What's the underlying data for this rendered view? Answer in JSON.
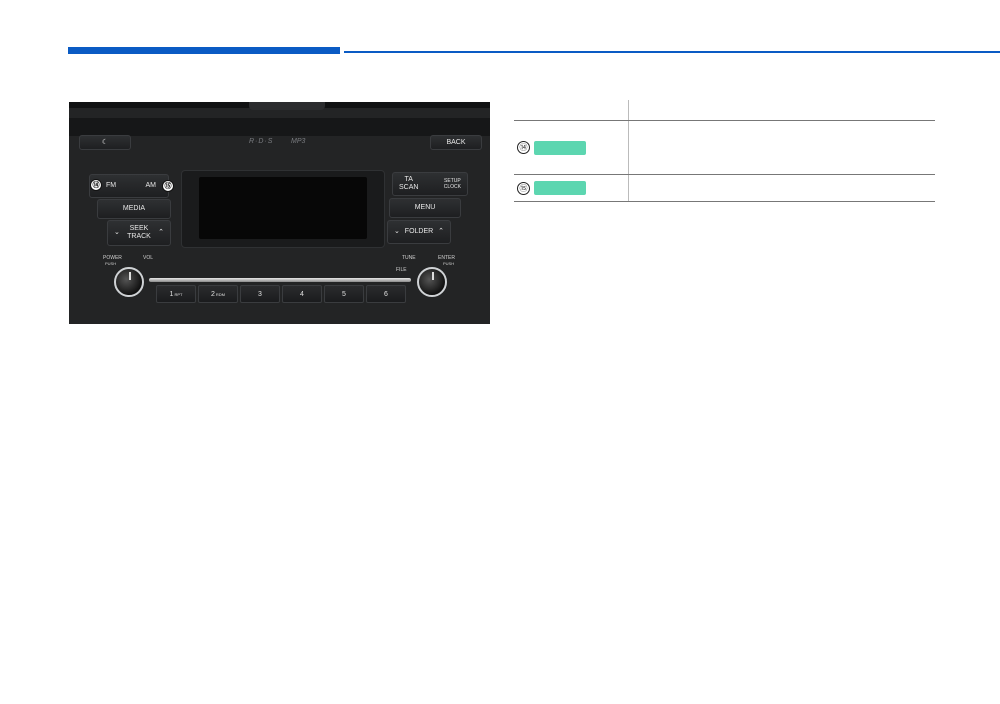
{
  "header": {
    "accent_color": "#0a5bc4"
  },
  "radio_panel": {
    "back_label": "BACK",
    "logo_text": "R·D·S",
    "logo_mp3": "MP3",
    "fm_label": "FM",
    "am_label": "AM",
    "media_label": "MEDIA",
    "seek_label": "SEEK",
    "track_label": "TRACK",
    "ta_label": "TA",
    "scan_label": "SCAN",
    "setup_label": "SETUP",
    "clock_label": "CLOCK",
    "menu_label": "MENU",
    "folder_label": "FOLDER",
    "power_label": "POWER",
    "push_label": "PUSH",
    "vol_label": "VOL",
    "tune_label": "TUNE",
    "file_label": "FILE",
    "enter_label": "ENTER",
    "enter_push_label": "PUSH",
    "presets": [
      {
        "num": "1",
        "sub": "RPT"
      },
      {
        "num": "2",
        "sub": "RDM"
      },
      {
        "num": "3",
        "sub": ""
      },
      {
        "num": "4",
        "sub": ""
      },
      {
        "num": "5",
        "sub": ""
      },
      {
        "num": "6",
        "sub": ""
      }
    ],
    "callout_14": "⑭",
    "callout_15": "⑮"
  },
  "table": {
    "row_14_num": "⑭",
    "row_15_num": "⑮",
    "chip_color": "#5cd6b0"
  }
}
